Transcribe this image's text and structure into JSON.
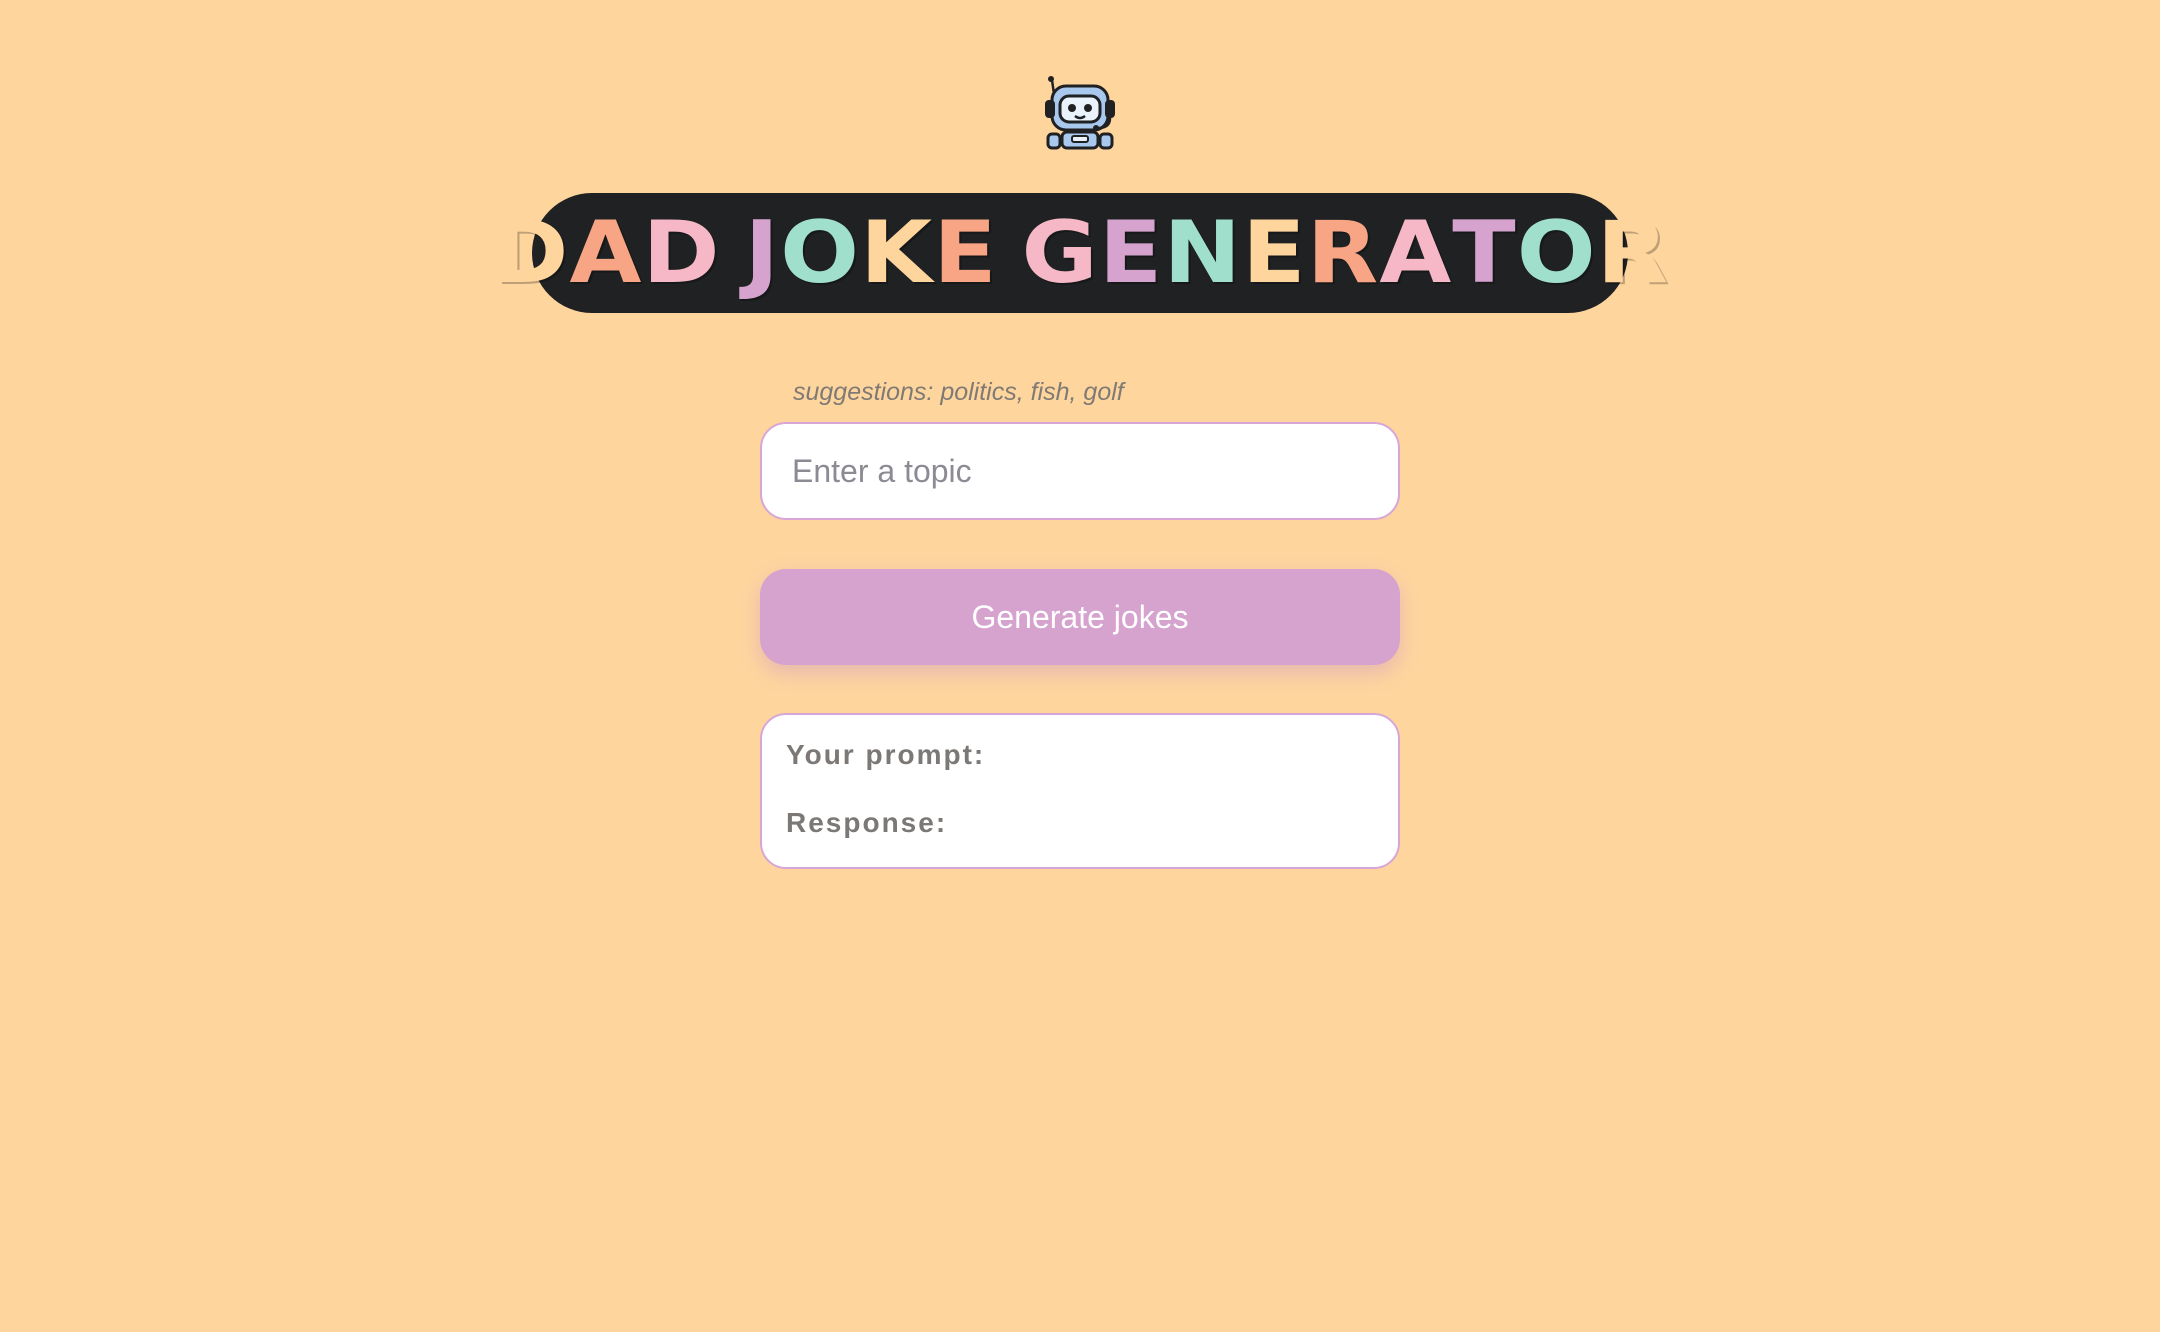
{
  "header": {
    "icon": "robot-icon",
    "title_letters": [
      {
        "char": "D",
        "color": "#ffd59e"
      },
      {
        "char": "A",
        "color": "#f8a585"
      },
      {
        "char": "D",
        "color": "#f6b8c6"
      },
      {
        "char": " ",
        "color": "#ffffff"
      },
      {
        "char": "J",
        "color": "#d6a3cf"
      },
      {
        "char": "O",
        "color": "#9fdfcb"
      },
      {
        "char": "K",
        "color": "#ffd59e"
      },
      {
        "char": "E",
        "color": "#f8a585"
      },
      {
        "char": " ",
        "color": "#ffffff"
      },
      {
        "char": "G",
        "color": "#f6b8c6"
      },
      {
        "char": "E",
        "color": "#d6a3cf"
      },
      {
        "char": "N",
        "color": "#9fdfcb"
      },
      {
        "char": "E",
        "color": "#ffd59e"
      },
      {
        "char": "R",
        "color": "#f8a585"
      },
      {
        "char": "A",
        "color": "#f6b8c6"
      },
      {
        "char": "T",
        "color": "#d6a3cf"
      },
      {
        "char": "O",
        "color": "#9fdfcb"
      },
      {
        "char": "R",
        "color": "#ffd59e"
      }
    ]
  },
  "form": {
    "suggestions": "suggestions: politics, fish, golf",
    "topic_placeholder": "Enter a topic",
    "topic_value": "",
    "generate_label": "Generate jokes"
  },
  "result": {
    "prompt_label": "Your prompt:",
    "response_label": "Response:"
  },
  "colors": {
    "background": "#ffd59e",
    "title_bg": "#1f2123",
    "button": "#d6a3cf",
    "border": "#d7a6d6"
  }
}
